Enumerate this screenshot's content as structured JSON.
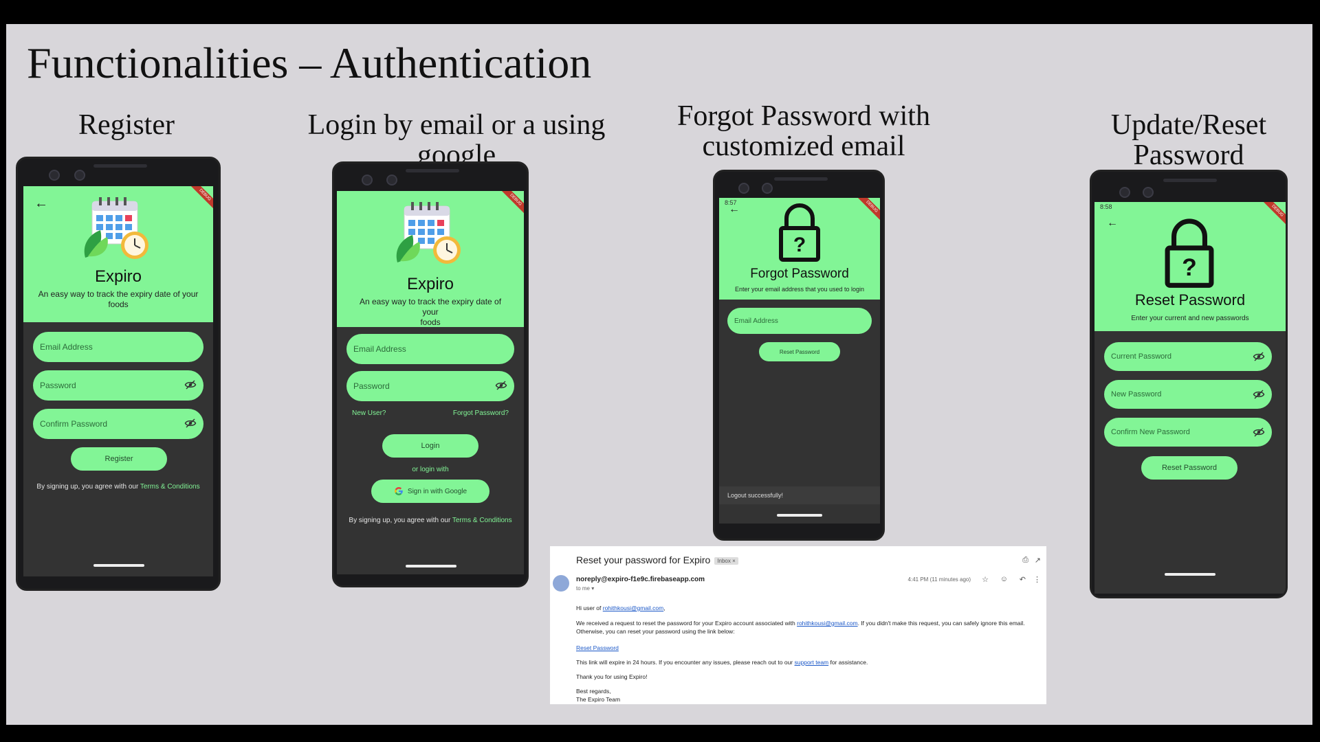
{
  "slide_title": "Functionalities – Authentication",
  "sections": {
    "register": "Register",
    "login": "Login by email or a using google",
    "forgot_line1": "Forgot Password with",
    "forgot_line2": "customized email",
    "reset": "Update/Reset Password"
  },
  "colors": {
    "accent": "#82f596",
    "screen_bg": "#333333",
    "slide_bg": "#d8d6da"
  },
  "app": {
    "name": "Expiro",
    "tagline_line1": "An easy way to track the expiry date of your",
    "tagline_line2": "foods",
    "debug_label": "DEBUG"
  },
  "register": {
    "email_placeholder": "Email Address",
    "password_placeholder": "Password",
    "confirm_placeholder": "Confirm Password",
    "button": "Register",
    "terms_prefix": "By signing up, you agree with our ",
    "terms_link": "Terms & Conditions"
  },
  "login": {
    "email_placeholder": "Email Address",
    "password_placeholder": "Password",
    "new_user": "New User?",
    "forgot": "Forgot Password?",
    "button": "Login",
    "or_login": "or login with",
    "google_button": "Sign in with Google",
    "terms_prefix": "By signing up, you agree with our ",
    "terms_link": "Terms & Conditions"
  },
  "forgot": {
    "status_time": "8:57",
    "title": "Forgot Password",
    "subtitle": "Enter your email address that you used to login",
    "email_placeholder": "Email Address",
    "button": "Reset Password",
    "snackbar": "Logout successfully!"
  },
  "reset": {
    "status_time": "8:58",
    "title": "Reset Password",
    "subtitle": "Enter your current and new passwords",
    "current_placeholder": "Current Password",
    "new_placeholder": "New Password",
    "confirm_placeholder": "Confirm New Password",
    "button": "Reset Password"
  },
  "email": {
    "subject": "Reset your password for Expiro",
    "inbox_label": "Inbox ×",
    "from": "noreply@expiro-f1e9c.firebaseapp.com",
    "to": "to me ▾",
    "time": "4:41 PM (11 minutes ago)",
    "greeting_prefix": "Hi user of ",
    "greeting_email": "rohithkousi@gmail.com",
    "greeting_suffix": ",",
    "body1_prefix": "We received a request to reset the password for your Expiro account associated with ",
    "body1_email": "rohithkousi@gmail.com",
    "body1_suffix": ". If you didn't make this request, you can safely ignore this email.",
    "body2": "Otherwise, you can reset your password using the link below:",
    "reset_link": "Reset Password",
    "body3_prefix": "This link will expire in 24 hours. If you encounter any issues, please reach out to our ",
    "support_link": "support team",
    "body3_suffix": " for assistance.",
    "thanks": "Thank you for using Expiro!",
    "regards": "Best regards,",
    "team": "The Expiro Team"
  }
}
